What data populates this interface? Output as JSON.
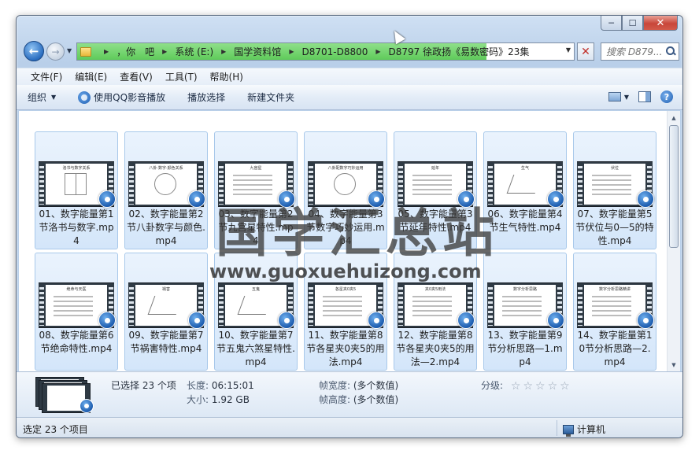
{
  "window": {
    "caption": {
      "minimize": "─",
      "maximize": "☐",
      "close": "✕"
    }
  },
  "address": {
    "crumbs": [
      "，你　吧",
      "系统 (E:)",
      "国学资料馆",
      "D8701-D8800",
      "D8797 徐政扬《易数密码》23集"
    ]
  },
  "search": {
    "placeholder": "搜索 D879..."
  },
  "menu": [
    "文件(F)",
    "编辑(E)",
    "查看(V)",
    "工具(T)",
    "帮助(H)"
  ],
  "toolbar": {
    "organize": "组织",
    "play_qq": "使用QQ影音播放",
    "play_selection": "播放选择",
    "new_folder": "新建文件夹"
  },
  "files": [
    {
      "name": "01、数字能量第1节洛书与数字.mp4",
      "slide": "洛书与数字关系"
    },
    {
      "name": "02、数字能量第2节八卦数字与颜色.mp4",
      "slide": "八卦·数字·颜色关系"
    },
    {
      "name": "03、数字能量第2节九宫星特性.mp4",
      "slide": "九宫星"
    },
    {
      "name": "04、数字能量第3节数字巧妙运用.mp4",
      "slide": "八卦配数字巧妙运用"
    },
    {
      "name": "05、数字能量第3节延年特性.mp4",
      "slide": "延年"
    },
    {
      "name": "06、数字能量第4节生气特性.mp4",
      "slide": "生气"
    },
    {
      "name": "07、数字能量第5节伏位与0—5的特性.mp4",
      "slide": "伏位"
    },
    {
      "name": "08、数字能量第6节绝命特性.mp4",
      "slide": "绝命与天医"
    },
    {
      "name": "09、数字能量第7节祸害特性.mp4",
      "slide": "祸害"
    },
    {
      "name": "10、数字能量第7节五鬼六煞星特性.mp4",
      "slide": "五鬼"
    },
    {
      "name": "11、数字能量第8节各星夹0夹5的用法.mp4",
      "slide": "各星夹0夹5"
    },
    {
      "name": "12、数字能量第8节各星夹0夹5的用法—2.mp4",
      "slide": "夹0夹5用法"
    },
    {
      "name": "13、数字能量第9节分析思路—1.mp4",
      "slide": "数字分析思路"
    },
    {
      "name": "14、数字能量第10节分析思路—2.mp4",
      "slide": "数字分析思路精讲"
    }
  ],
  "watermark": {
    "cn": "国学汇总站",
    "url": "www.guoxuehuizong.com"
  },
  "details": {
    "selected": "已选择 23 个项",
    "length_label": "长度:",
    "length_value": "06:15:01",
    "size_label": "大小:",
    "size_value": "1.92 GB",
    "frame_width_label": "帧宽度:",
    "frame_width_value": "(多个数值)",
    "frame_height_label": "帧高度:",
    "frame_height_value": "(多个数值)",
    "rating_label": "分级:",
    "rating_value": 0,
    "rating_max": 5
  },
  "status": {
    "left": "选定 23 个项目",
    "right": "计算机"
  }
}
